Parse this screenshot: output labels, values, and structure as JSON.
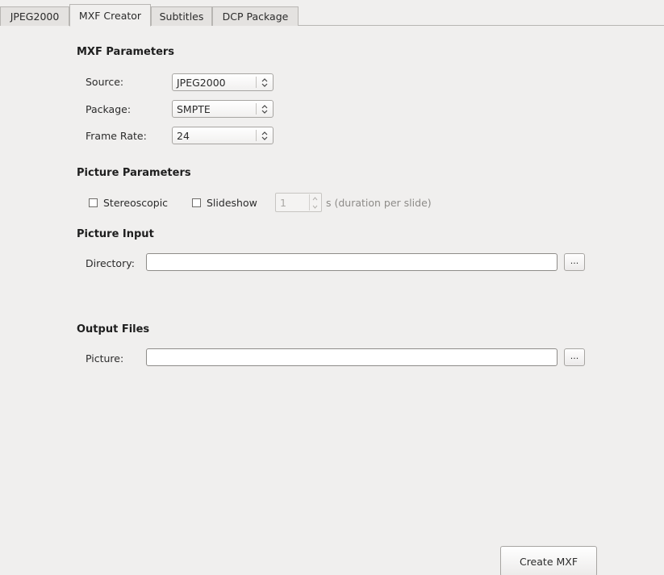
{
  "tabs": [
    {
      "label": "JPEG2000",
      "active": false
    },
    {
      "label": "MXF Creator",
      "active": true
    },
    {
      "label": "Subtitles",
      "active": false
    },
    {
      "label": "DCP Package",
      "active": false
    }
  ],
  "mxf_parameters": {
    "title": "MXF Parameters",
    "source_label": "Source:",
    "source_value": "JPEG2000",
    "package_label": "Package:",
    "package_value": "SMPTE",
    "frame_rate_label": "Frame Rate:",
    "frame_rate_value": "24"
  },
  "picture_parameters": {
    "title": "Picture Parameters",
    "stereoscopic_label": "Stereoscopic",
    "stereoscopic_checked": false,
    "slideshow_label": "Slideshow",
    "slideshow_checked": false,
    "slide_duration_value": "1",
    "slide_duration_suffix": "s (duration per slide)"
  },
  "picture_input": {
    "title": "Picture Input",
    "directory_label": "Directory:",
    "directory_value": "",
    "browse_label": "..."
  },
  "output_files": {
    "title": "Output Files",
    "picture_label": "Picture:",
    "picture_value": "",
    "browse_label": "..."
  },
  "actions": {
    "create_label": "Create MXF"
  },
  "colors": {
    "window_bg": "#f0efee",
    "border": "#b8b6b3",
    "disabled_text": "#8d8b88"
  }
}
